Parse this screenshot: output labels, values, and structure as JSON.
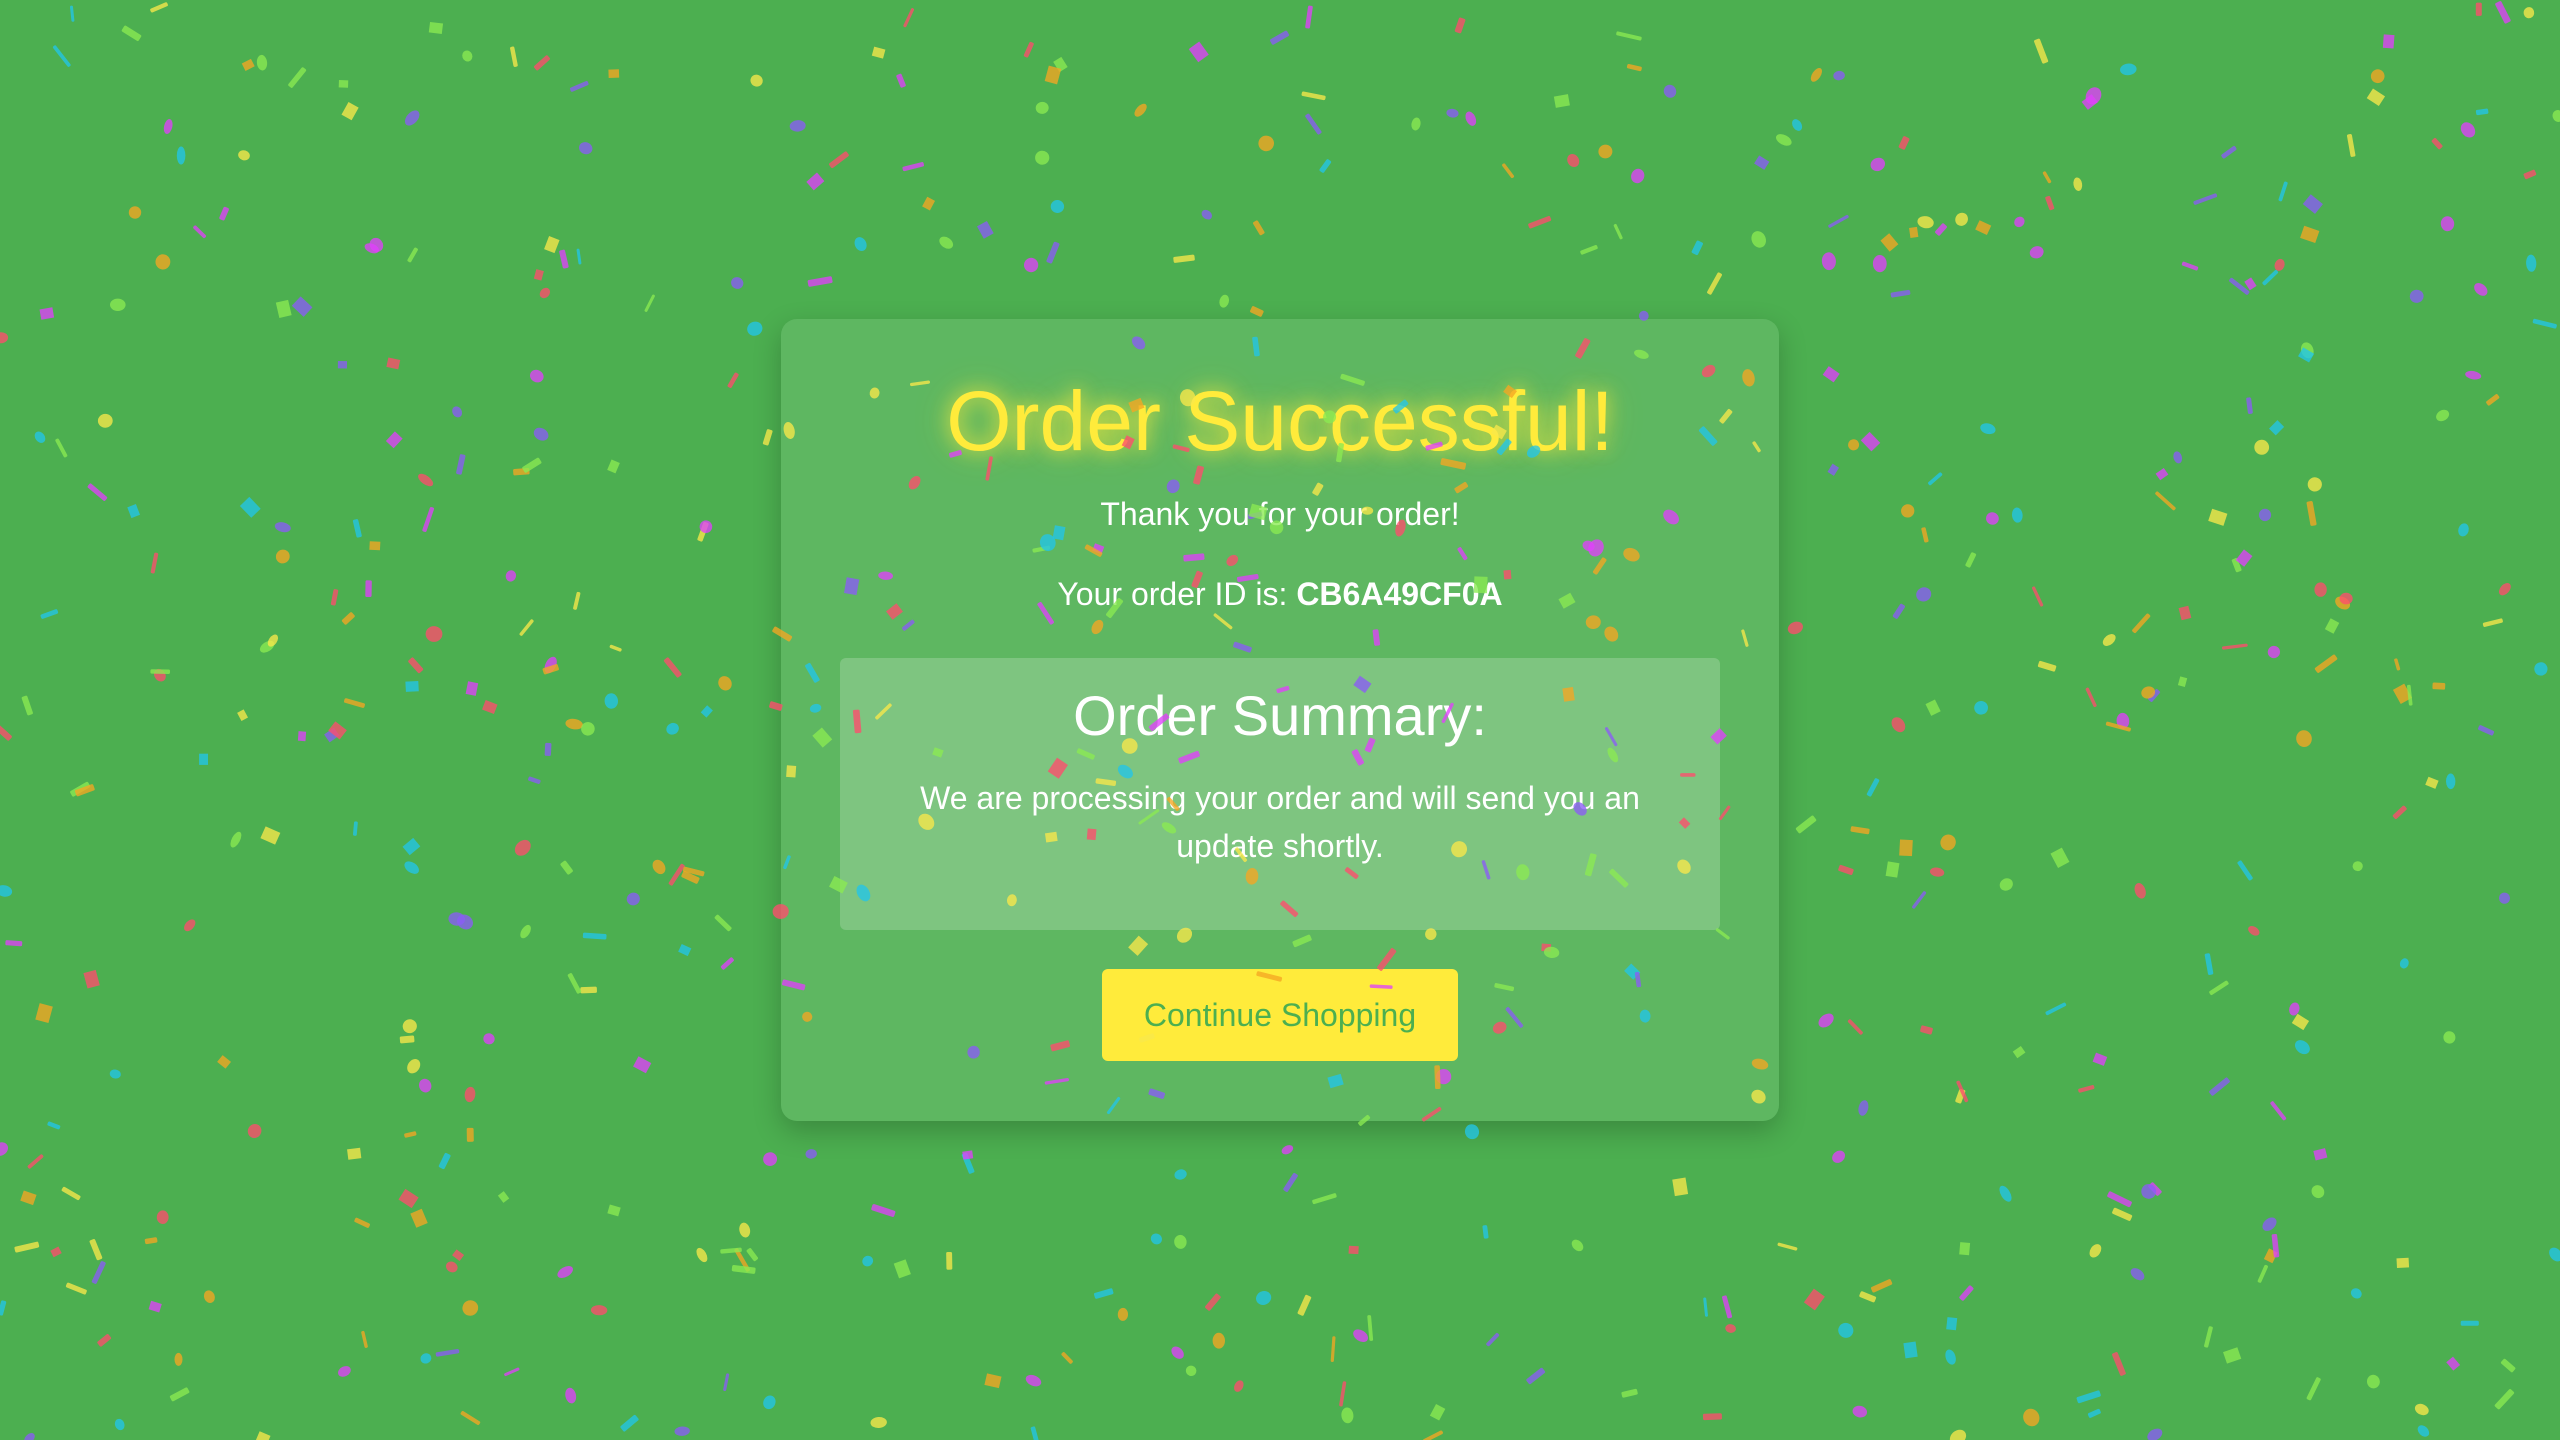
{
  "page": {
    "background_color": "#4caf50",
    "accent_color": "#ffeb3b"
  },
  "card": {
    "title": "Order Successful!",
    "thanks": "Thank you for your order!",
    "order_id_prefix": "Your order ID is:",
    "order_id": "CB6A49CF0A"
  },
  "summary": {
    "title": "Order Summary:",
    "text": "We are processing your order and will send you an update shortly."
  },
  "actions": {
    "continue_label": "Continue Shopping"
  },
  "confetti": {
    "colors": [
      "#ff4d6d",
      "#f9e84a",
      "#8bea52",
      "#22c5e8",
      "#8b5cf6",
      "#f5a623",
      "#e040fb"
    ]
  }
}
